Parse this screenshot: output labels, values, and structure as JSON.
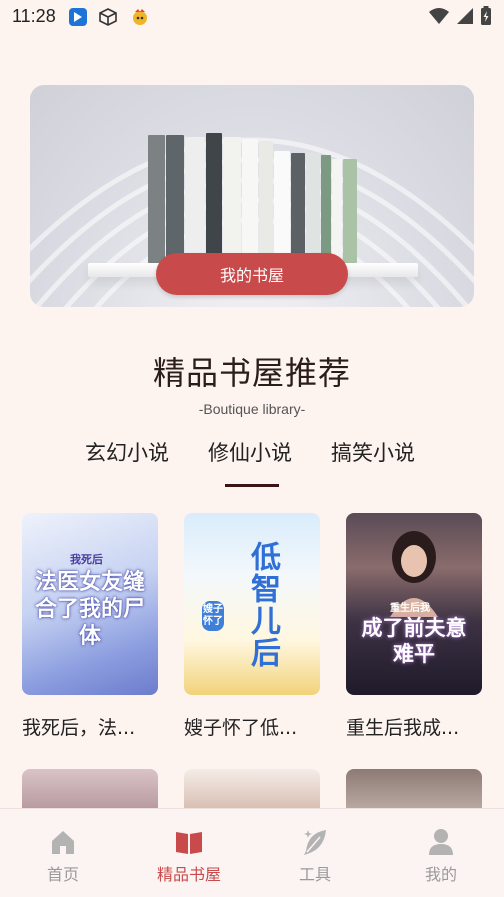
{
  "status": {
    "time": "11:28"
  },
  "hero": {
    "button_label": "我的书屋"
  },
  "section": {
    "title": "精品书屋推荐",
    "subtitle": "-Boutique library-"
  },
  "tabs": [
    {
      "label": "玄幻小说"
    },
    {
      "label": "修仙小说",
      "active": true
    },
    {
      "label": "搞笑小说"
    }
  ],
  "books": [
    {
      "title": "我死后，法...",
      "cover_title": "法医女友缝合了我的尸体",
      "cover_tag": "我死后"
    },
    {
      "title": "嫂子怀了低...",
      "cover_title": "低智儿后",
      "cover_tag": "嫂子怀了"
    },
    {
      "title": "重生后我成...",
      "cover_title": "成了前夫意难平",
      "cover_tag": "重生后我"
    }
  ],
  "nav": [
    {
      "label": "首页",
      "icon": "home-icon"
    },
    {
      "label": "精品书屋",
      "icon": "book-icon",
      "active": true
    },
    {
      "label": "工具",
      "icon": "feather-icon"
    },
    {
      "label": "我的",
      "icon": "user-icon"
    }
  ],
  "colors": {
    "accent": "#c94a4b",
    "background": "#fdf3ef"
  }
}
